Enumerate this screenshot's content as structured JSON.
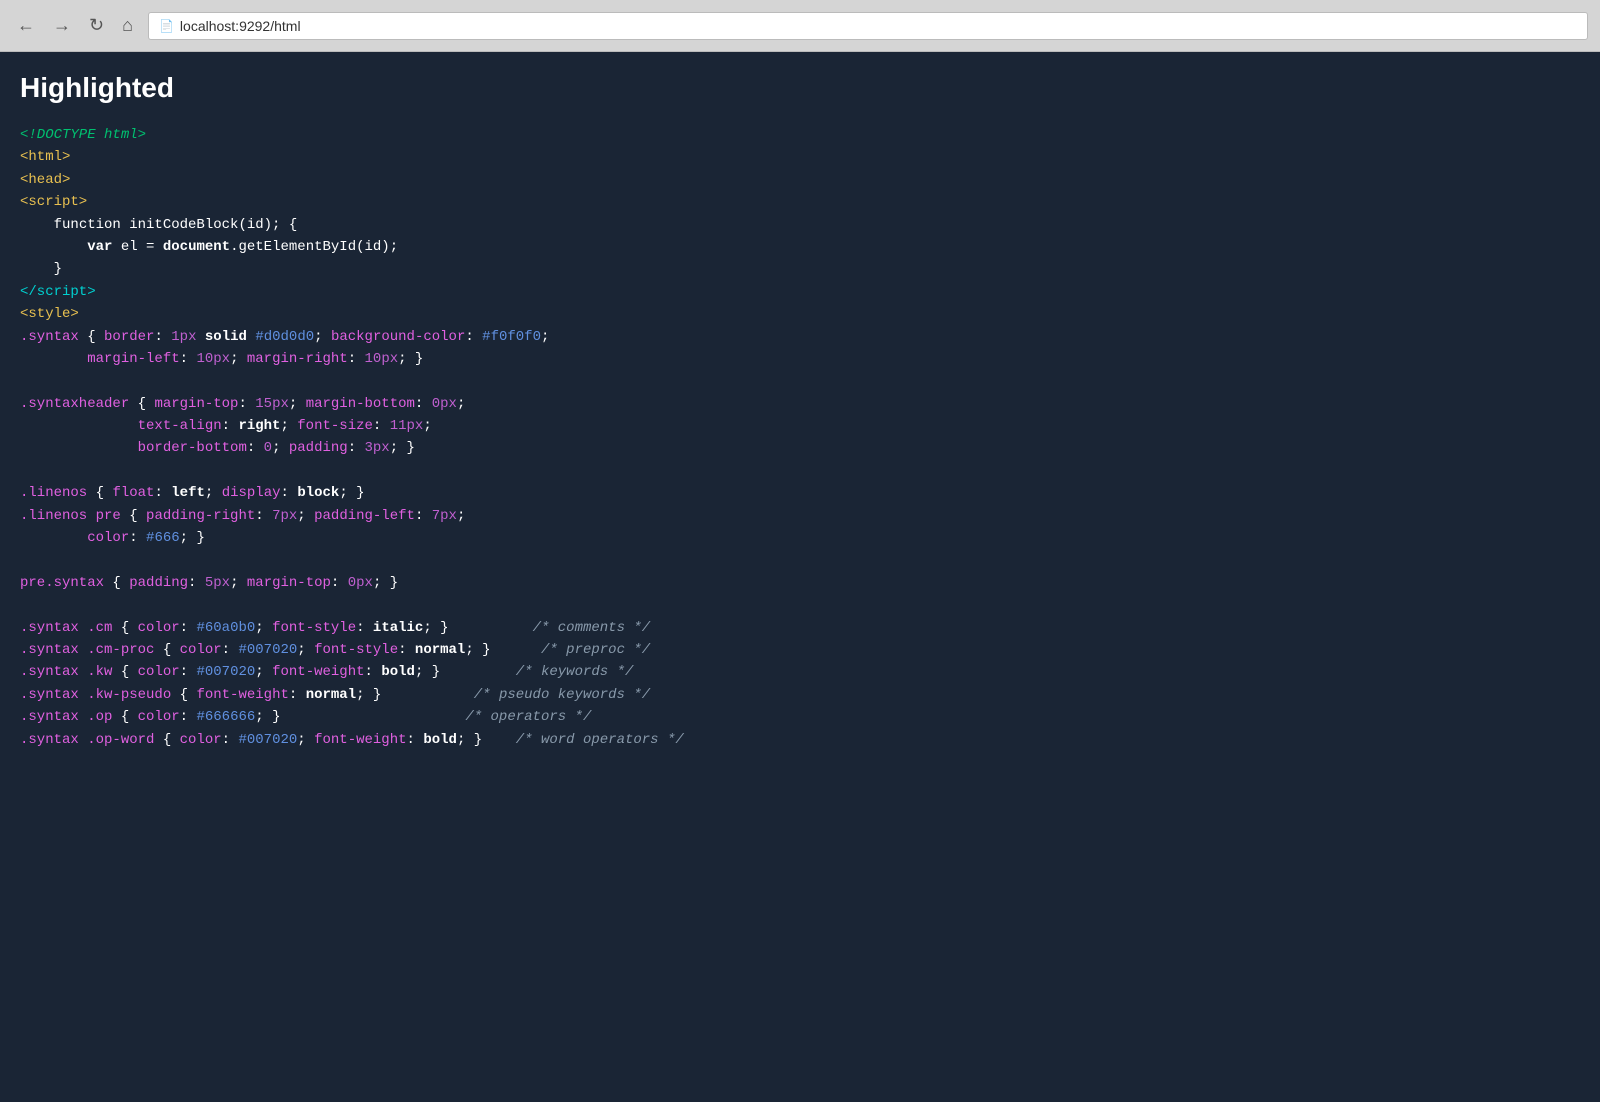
{
  "browser": {
    "url": "localhost:9292/html",
    "back_title": "Back",
    "forward_title": "Forward",
    "refresh_title": "Refresh",
    "home_title": "Home"
  },
  "page": {
    "title": "Highlighted"
  }
}
